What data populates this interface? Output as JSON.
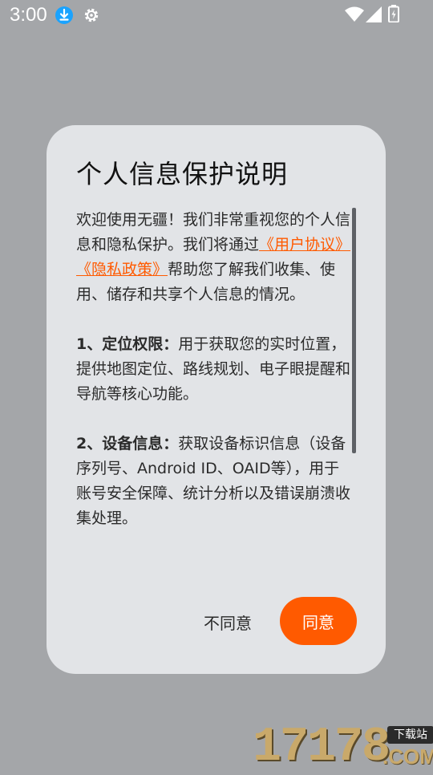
{
  "status_bar": {
    "time": "3:00",
    "icons": [
      "download-icon",
      "gear-icon",
      "wifi-icon",
      "signal-icon",
      "battery-icon"
    ],
    "download_icon_color": "#1aa3ff"
  },
  "dialog": {
    "title": "个人信息保护说明",
    "intro": {
      "part1": "欢迎使用无疆！我们非常重视您的个人信息和隐私保护。我们将通过",
      "link_user_agreement": "《用户协议》",
      "link_privacy_policy": "《隐私政策》",
      "part2": "帮助您了解我们收集、使用、储存和共享个人信息的情况。"
    },
    "item1": {
      "heading": "1、定位权限：",
      "text": "用于获取您的实时位置，提供地图定位、路线规划、电子眼提醒和导航等核心功能。"
    },
    "item2": {
      "heading": "2、设备信息：",
      "text": "获取设备标识信息（设备序列号、Android ID、OAID等），用于账号安全保障、统计分析以及错误崩溃收集处理。"
    },
    "buttons": {
      "disagree": "不同意",
      "agree": "同意"
    },
    "accent_color": "#ff5a00"
  },
  "watermark": {
    "number": "17178",
    "site_label": "下载站",
    "domain": ".COM"
  }
}
